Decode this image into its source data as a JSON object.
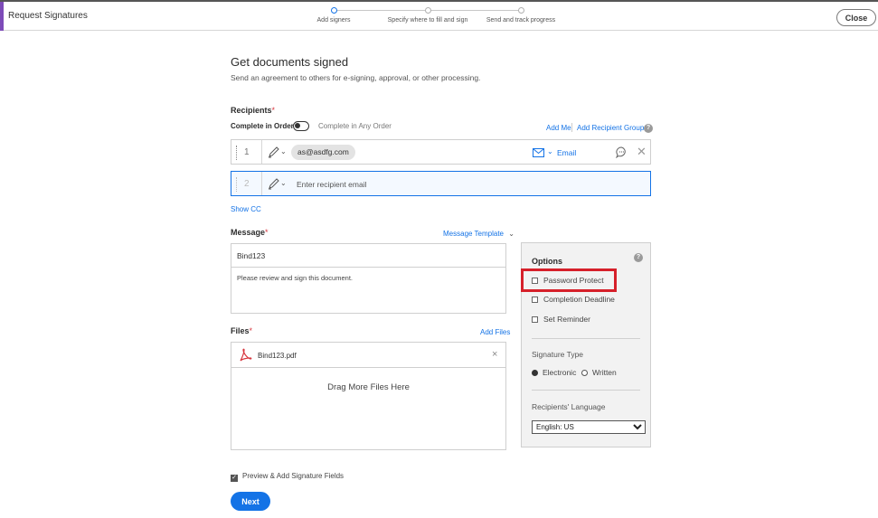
{
  "header": {
    "app_title": "Request Signatures",
    "steps": [
      {
        "label": "Add signers",
        "active": true
      },
      {
        "label": "Specify where to fill and sign",
        "active": false
      },
      {
        "label": "Send and track progress",
        "active": false
      }
    ],
    "close_label": "Close"
  },
  "page": {
    "title": "Get documents signed",
    "subtitle": "Send an agreement to others for e-signing, approval, or other processing."
  },
  "recipients": {
    "label": "Recipients",
    "required_mark": "*",
    "order_left": "Complete in Order",
    "order_right": "Complete in Any Order",
    "add_me": "Add Me",
    "add_group": "Add Recipient Group",
    "help": "?",
    "rows": [
      {
        "number": "1",
        "email": "as@asdfg.com",
        "auth": "Email"
      },
      {
        "number": "2",
        "placeholder": "Enter recipient email"
      }
    ],
    "show_cc": "Show CC"
  },
  "message": {
    "label": "Message",
    "required_mark": "*",
    "template_link": "Message Template",
    "title_value": "Bind123",
    "body_value": "Please review and sign this document."
  },
  "files": {
    "label": "Files",
    "required_mark": "*",
    "add_files": "Add Files",
    "file_name": "Bind123.pdf",
    "drop_text": "Drag More Files Here"
  },
  "options": {
    "title": "Options",
    "help": "?",
    "password_protect": "Password Protect",
    "completion_deadline": "Completion Deadline",
    "set_reminder": "Set Reminder",
    "signature_type_label": "Signature Type",
    "electronic": "Electronic",
    "written": "Written",
    "language_label": "Recipients' Language",
    "language_value": "English: US"
  },
  "footer": {
    "preview_label": "Preview & Add Signature Fields",
    "next_label": "Next"
  },
  "colors": {
    "accent": "#1473e6",
    "highlight": "#d6202a",
    "brand": "#7d4bb8"
  }
}
